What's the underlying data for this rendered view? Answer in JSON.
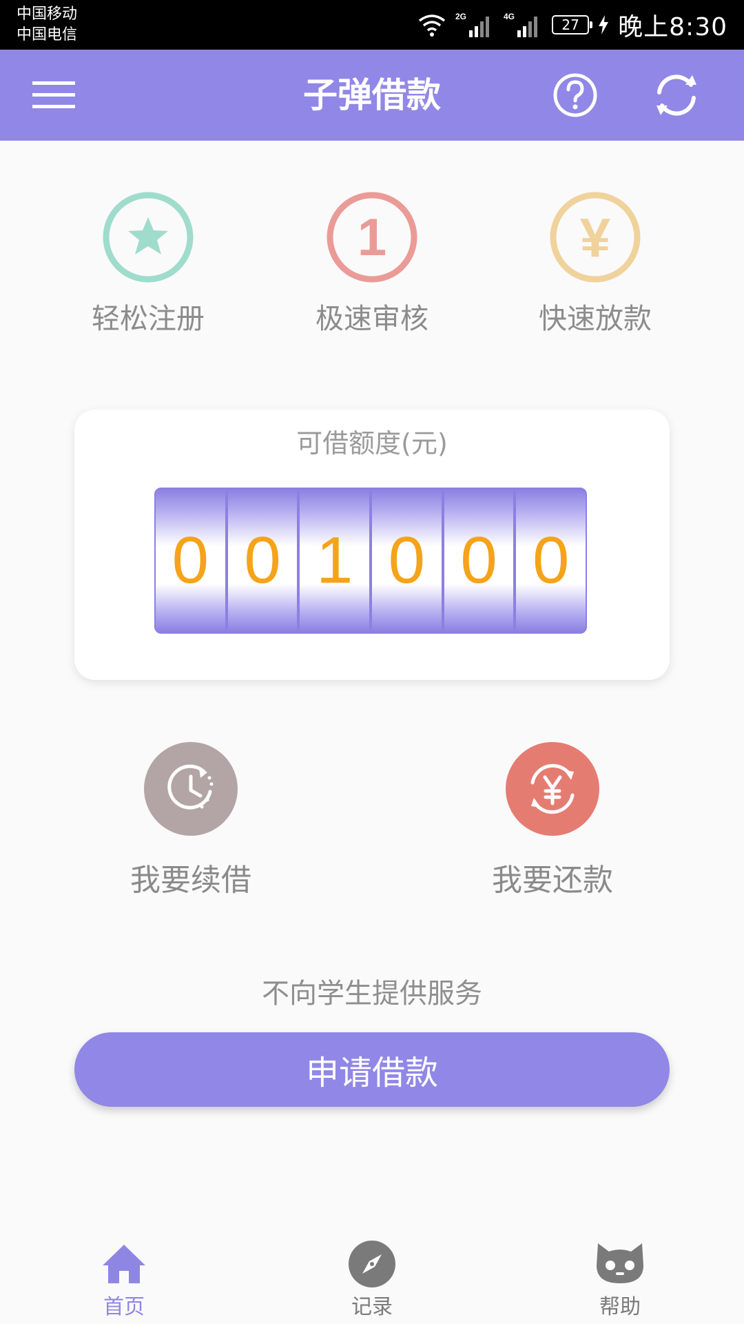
{
  "status_bar": {
    "carrier_1": "中国移动",
    "carrier_2": "中国电信",
    "network_1": "2G",
    "network_2": "4G",
    "battery": "27",
    "time": "晚上8:30",
    "icons": [
      "wifi-icon",
      "signal-icon",
      "battery-icon",
      "charging-icon"
    ]
  },
  "app_bar": {
    "title": "子弹借款",
    "icons": [
      "menu-icon",
      "help-icon",
      "refresh-icon"
    ],
    "color": "#9187e6"
  },
  "features": [
    {
      "label": "轻松注册",
      "icon": "star-icon",
      "color": "#9fdccc"
    },
    {
      "label": "极速审核",
      "icon": "number-one-icon",
      "glyph": "1",
      "color": "#eb9b97"
    },
    {
      "label": "快速放款",
      "icon": "yuan-icon",
      "glyph": "¥",
      "color": "#f0d29c"
    }
  ],
  "credit": {
    "title": "可借额度(元)",
    "digits": [
      "0",
      "0",
      "1",
      "0",
      "0",
      "0"
    ],
    "digit_color": "#f5a31a"
  },
  "actions": [
    {
      "label": "我要续借",
      "icon": "clock-renew-icon",
      "color": "#b3a5a5"
    },
    {
      "label": "我要还款",
      "icon": "yuan-exchange-icon",
      "color": "#e57c72"
    }
  ],
  "notice": "不向学生提供服务",
  "apply_button": {
    "label": "申请借款"
  },
  "bottom_nav": [
    {
      "label": "首页",
      "icon": "home-icon",
      "active": true
    },
    {
      "label": "记录",
      "icon": "compass-icon",
      "active": false
    },
    {
      "label": "帮助",
      "icon": "github-cat-icon",
      "active": false
    }
  ],
  "colors": {
    "primary": "#9187e6",
    "background": "#fafafa",
    "text": "#8a8a8a"
  }
}
